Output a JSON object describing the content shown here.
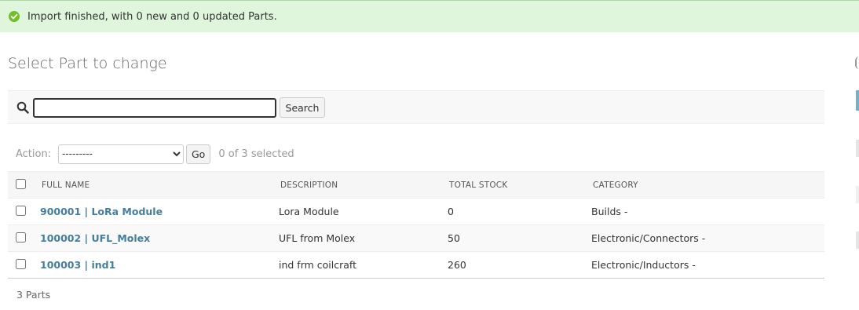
{
  "message": {
    "text": "Import finished, with 0 new and 0 updated Parts.",
    "color": "#dff6dd",
    "icon": "check-circle-icon"
  },
  "page": {
    "title": "Select Part to change"
  },
  "search": {
    "value": "",
    "placeholder": "",
    "button_label": "Search",
    "icon": "search-icon"
  },
  "actions": {
    "label": "Action:",
    "selected_option": "---------",
    "go_label": "Go",
    "counter": "0 of 3 selected"
  },
  "table": {
    "headers": {
      "full_name": "Full name",
      "description": "Description",
      "total_stock": "Total stock",
      "category": "Category"
    },
    "rows": [
      {
        "full_name": "900001 | LoRa Module",
        "description": "Lora Module",
        "total_stock": "0",
        "category": "Builds -"
      },
      {
        "full_name": "100002 | UFL_Molex",
        "description": "UFL from Molex",
        "total_stock": "50",
        "category": "Electronic/Connectors -"
      },
      {
        "full_name": "100003 | ind1",
        "description": "ind frm coilcraft",
        "total_stock": "260",
        "category": "Electronic/Inductors -"
      }
    ]
  },
  "paginator": {
    "text": "3 Parts"
  },
  "colors": {
    "link": "#447e9b",
    "accent": "#79aec8",
    "success": "#dff6dd"
  }
}
